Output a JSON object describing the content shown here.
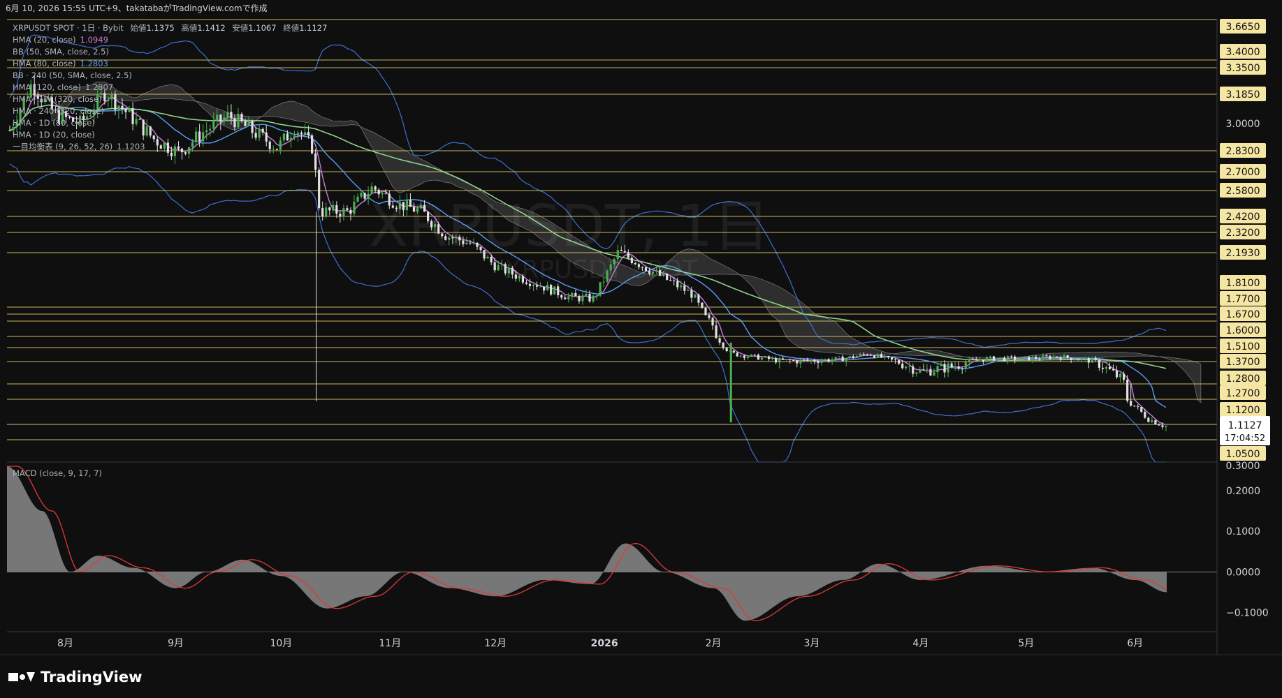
{
  "header": {
    "created_line": "6月 10, 2026 15:55 UTC+9、takatabaがTradingView.comで作成"
  },
  "legend": {
    "symbol_line": "XRPUSDT SPOT · 1日 · Bybit",
    "open_label": "始値",
    "open": "1.1375",
    "high_label": "高値",
    "high": "1.1412",
    "low_label": "安値",
    "low": "1.1067",
    "close_label": "終値",
    "close": "1.1127",
    "items": [
      {
        "label": "HMA (20, close)",
        "value": "1.0949",
        "color": "#c77ddb"
      },
      {
        "label": "BB (50, SMA, close, 2.5)",
        "value": "",
        "color": "#b2b5be"
      },
      {
        "label": "HMA (80, close)",
        "value": "1.2803",
        "color": "#5b9cf6"
      },
      {
        "label": "BB · 240 (50, SMA, close, 2.5)",
        "value": "",
        "color": "#b2b5be"
      },
      {
        "label": "HMA (120, close)",
        "value": "1.2807",
        "color": "#b2b5be"
      },
      {
        "label": "HMA · 1W (320, close)",
        "value": "",
        "color": "#b2b5be"
      },
      {
        "label": "HMA · 240 (320, close)",
        "value": "",
        "color": "#b2b5be"
      },
      {
        "label": "HMA · 1D (80, close)",
        "value": "",
        "color": "#b2b5be"
      },
      {
        "label": "HMA · 1D (20, close)",
        "value": "",
        "color": "#b2b5be"
      },
      {
        "label": "一目均衡表 (9, 26, 52, 26)",
        "value": "1.1203",
        "color": "#b2b5be"
      }
    ]
  },
  "watermark": {
    "main": "XRPUSDT, 1日",
    "sub": "XRPUSDT SPOT"
  },
  "price_axis": {
    "ticks": [
      "3.0000",
      "0.3000"
    ]
  },
  "horizontal_levels": [
    "3.6650",
    "3.4000",
    "3.3500",
    "3.1850",
    "2.8300",
    "2.7000",
    "2.5800",
    "2.4200",
    "2.3200",
    "2.1930",
    "1.8100",
    "1.7700",
    "1.6700",
    "1.6000",
    "1.5100",
    "1.3700",
    "1.2800",
    "1.2700",
    "1.1200",
    "1.0500"
  ],
  "current_price": {
    "value": "1.1127",
    "countdown": "17:04:52"
  },
  "macd": {
    "title": "MACD (close, 9, 17, 7)",
    "ticks": [
      "0.2000",
      "0.1000",
      "0.0000",
      "−0.1000"
    ]
  },
  "time_axis": {
    "labels": [
      "8月",
      "9月",
      "10月",
      "11月",
      "12月",
      "2026",
      "2月",
      "3月",
      "4月",
      "5月",
      "6月"
    ]
  },
  "brand": {
    "name": "TradingView"
  },
  "colors": {
    "background": "#0f0f0f",
    "level_line": "#e8d36a",
    "level_label_bg": "#f5e6a3",
    "up_candle": "#4caf50",
    "down_candle": "#e0e0e0",
    "hma20": "#c77ddb",
    "hma80": "#5b9cf6",
    "hma320": "#8fd18c",
    "bband": "#3f6fd0",
    "cloud": "#555555",
    "macd_hist": "#8a8a8a",
    "macd_signal": "#e03838"
  },
  "chart_data": {
    "type": "candlestick",
    "symbol": "XRPUSDT SPOT",
    "timeframe": "1日",
    "exchange": "Bybit",
    "ohlc_last": {
      "open": 1.1375,
      "high": 1.1412,
      "low": 1.1067,
      "close": 1.1127
    },
    "x_range": [
      "2025-07-15",
      "2026-06-10"
    ],
    "x_months": [
      {
        "label": "8月",
        "date": "2025-08-01"
      },
      {
        "label": "9月",
        "date": "2025-09-01"
      },
      {
        "label": "10月",
        "date": "2025-10-01"
      },
      {
        "label": "11月",
        "date": "2025-11-01"
      },
      {
        "label": "12月",
        "date": "2025-12-01"
      },
      {
        "label": "2026",
        "date": "2026-01-01"
      },
      {
        "label": "2月",
        "date": "2026-02-01"
      },
      {
        "label": "3月",
        "date": "2026-03-01"
      },
      {
        "label": "4月",
        "date": "2026-04-01"
      },
      {
        "label": "5月",
        "date": "2026-05-01"
      },
      {
        "label": "6月",
        "date": "2026-06-01"
      }
    ],
    "close_path": [
      [
        "2025-07-15",
        2.92
      ],
      [
        "2025-07-22",
        3.25
      ],
      [
        "2025-07-29",
        3.05
      ],
      [
        "2025-08-05",
        3.0
      ],
      [
        "2025-08-12",
        3.2
      ],
      [
        "2025-08-19",
        3.05
      ],
      [
        "2025-08-26",
        2.9
      ],
      [
        "2025-09-02",
        2.82
      ],
      [
        "2025-09-09",
        2.95
      ],
      [
        "2025-09-16",
        3.05
      ],
      [
        "2025-09-23",
        2.95
      ],
      [
        "2025-09-30",
        2.85
      ],
      [
        "2025-10-05",
        2.98
      ],
      [
        "2025-10-10",
        2.85
      ],
      [
        "2025-10-12",
        2.45
      ],
      [
        "2025-10-20",
        2.45
      ],
      [
        "2025-10-27",
        2.6
      ],
      [
        "2025-11-03",
        2.5
      ],
      [
        "2025-11-10",
        2.45
      ],
      [
        "2025-11-17",
        2.3
      ],
      [
        "2025-11-24",
        2.25
      ],
      [
        "2025-12-01",
        2.1
      ],
      [
        "2025-12-08",
        2.02
      ],
      [
        "2025-12-15",
        1.95
      ],
      [
        "2025-12-22",
        1.88
      ],
      [
        "2025-12-29",
        1.87
      ],
      [
        "2026-01-05",
        2.2
      ],
      [
        "2026-01-12",
        2.1
      ],
      [
        "2026-01-19",
        2.0
      ],
      [
        "2026-01-26",
        1.9
      ],
      [
        "2026-02-02",
        1.6
      ],
      [
        "2026-02-06",
        1.45
      ],
      [
        "2026-02-12",
        1.42
      ],
      [
        "2026-02-20",
        1.38
      ],
      [
        "2026-03-01",
        1.38
      ],
      [
        "2026-03-10",
        1.4
      ],
      [
        "2026-03-17",
        1.45
      ],
      [
        "2026-03-24",
        1.38
      ],
      [
        "2026-04-01",
        1.33
      ],
      [
        "2026-04-10",
        1.35
      ],
      [
        "2026-04-20",
        1.4
      ],
      [
        "2026-05-01",
        1.4
      ],
      [
        "2026-05-10",
        1.42
      ],
      [
        "2026-05-20",
        1.38
      ],
      [
        "2026-05-28",
        1.3
      ],
      [
        "2026-06-05",
        1.15
      ],
      [
        "2026-06-10",
        1.11
      ]
    ],
    "price_levels": [
      3.665,
      3.4,
      3.35,
      3.185,
      2.83,
      2.7,
      2.58,
      2.42,
      2.32,
      2.193,
      1.81,
      1.77,
      1.67,
      1.6,
      1.51,
      1.37,
      1.28,
      1.27,
      1.12,
      1.05
    ],
    "macd": {
      "params": "close, 9, 17, 7",
      "ylim": [
        -0.13,
        0.26
      ],
      "ticks": [
        0.2,
        0.1,
        0.0,
        -0.1
      ],
      "histogram_path": [
        [
          "2025-07-15",
          0.26
        ],
        [
          "2025-07-25",
          0.15
        ],
        [
          "2025-08-02",
          0.0
        ],
        [
          "2025-08-10",
          0.04
        ],
        [
          "2025-08-20",
          0.01
        ],
        [
          "2025-09-01",
          -0.04
        ],
        [
          "2025-09-10",
          0.0
        ],
        [
          "2025-09-20",
          0.03
        ],
        [
          "2025-10-01",
          -0.01
        ],
        [
          "2025-10-14",
          -0.09
        ],
        [
          "2025-10-25",
          -0.06
        ],
        [
          "2025-11-05",
          0.0
        ],
        [
          "2025-11-18",
          -0.04
        ],
        [
          "2025-12-01",
          -0.06
        ],
        [
          "2025-12-15",
          -0.02
        ],
        [
          "2025-12-28",
          -0.03
        ],
        [
          "2026-01-07",
          0.07
        ],
        [
          "2026-01-18",
          0.0
        ],
        [
          "2026-02-01",
          -0.04
        ],
        [
          "2026-02-10",
          -0.12
        ],
        [
          "2026-02-25",
          -0.06
        ],
        [
          "2026-03-10",
          -0.02
        ],
        [
          "2026-03-20",
          0.02
        ],
        [
          "2026-04-01",
          -0.02
        ],
        [
          "2026-04-20",
          0.015
        ],
        [
          "2026-05-05",
          0.0
        ],
        [
          "2026-05-20",
          0.01
        ],
        [
          "2026-06-01",
          -0.02
        ],
        [
          "2026-06-10",
          -0.05
        ]
      ]
    }
  }
}
